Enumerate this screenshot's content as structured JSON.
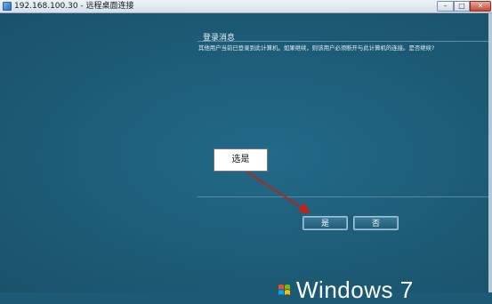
{
  "window": {
    "title": "192.168.100.30 - 远程桌面连接",
    "min_symbol": "–",
    "max_symbol": "□",
    "close_symbol": "✕"
  },
  "dialog": {
    "heading": "登录消息",
    "message": "其他用户当前已登录到此计算机。如果继续，则该用户必须断开与此计算机的连接。是否继续?",
    "yes_label": "是",
    "no_label": "否"
  },
  "annotation": {
    "label": "选是",
    "arrow_color": "#c0201a"
  },
  "os_logo": {
    "text": "Windows 7"
  }
}
